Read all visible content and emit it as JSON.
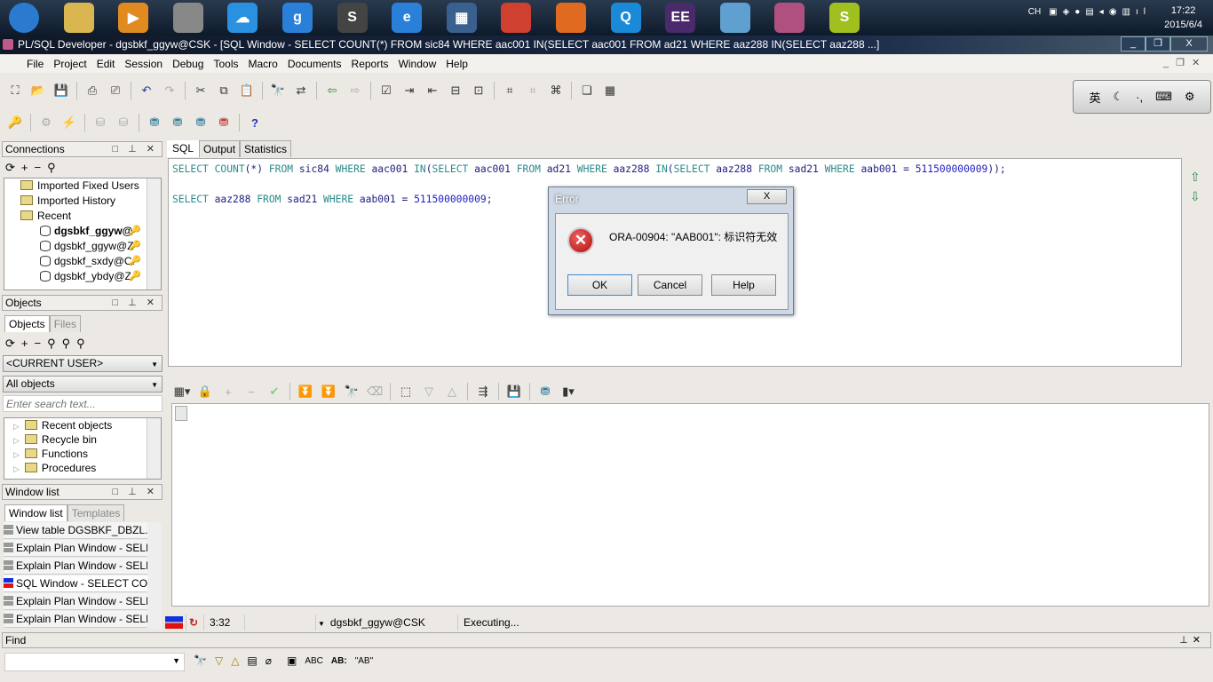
{
  "taskbar": {
    "apps": [
      {
        "name": "start-button",
        "label": "",
        "color": "#2a7ad0"
      },
      {
        "name": "file-explorer",
        "label": "",
        "color": "#d9b650"
      },
      {
        "name": "media-player",
        "label": "▶",
        "color": "#e08a20"
      },
      {
        "name": "speaker-app",
        "label": "",
        "color": "#888"
      },
      {
        "name": "baidu-cloud",
        "label": "☁",
        "color": "#2a90e0"
      },
      {
        "name": "app-blue",
        "label": "g",
        "color": "#2a80d8"
      },
      {
        "name": "sublime-text",
        "label": "S",
        "color": "#444"
      },
      {
        "name": "internet-explorer",
        "label": "e",
        "color": "#2a80d8"
      },
      {
        "name": "video-app",
        "label": "▦",
        "color": "#3a6090"
      },
      {
        "name": "chrome",
        "label": "",
        "color": "#d04030"
      },
      {
        "name": "firefox",
        "label": "",
        "color": "#e06a20"
      },
      {
        "name": "app-q",
        "label": "Q",
        "color": "#1a8ad8"
      },
      {
        "name": "java-ee-ide",
        "label": "EE",
        "color": "#4a2a6a"
      },
      {
        "name": "paint-app",
        "label": "",
        "color": "#60a0d0"
      },
      {
        "name": "plsql-developer",
        "label": "",
        "color": "#b05080"
      },
      {
        "name": "app-green",
        "label": "S",
        "color": "#a0c020"
      }
    ],
    "tray": {
      "lang": "CH",
      "time": "17:22",
      "date": "2015/6/4"
    }
  },
  "window": {
    "title": "PL/SQL Developer - dgsbkf_ggyw@CSK - [SQL Window - SELECT COUNT(*) FROM sic84 WHERE aac001 IN(SELECT aac001 FROM ad21 WHERE aaz288 IN(SELECT aaz288 ...]"
  },
  "menu": [
    "File",
    "Project",
    "Edit",
    "Session",
    "Debug",
    "Tools",
    "Macro",
    "Documents",
    "Reports",
    "Window",
    "Help"
  ],
  "ime": {
    "items": [
      "英",
      "☾",
      "·,",
      "⌨",
      "⚙"
    ]
  },
  "connections": {
    "title": "Connections",
    "items": [
      {
        "label": "Imported Fixed Users",
        "type": "folder"
      },
      {
        "label": "Imported History",
        "type": "folder"
      },
      {
        "label": "Recent",
        "type": "folder"
      },
      {
        "label": "dgsbkf_ggyw@",
        "type": "db",
        "bold": true
      },
      {
        "label": "dgsbkf_ggyw@Z",
        "type": "db"
      },
      {
        "label": "dgsbkf_sxdy@C:",
        "type": "db"
      },
      {
        "label": "dgsbkf_ybdy@Z",
        "type": "db"
      }
    ]
  },
  "objects": {
    "title": "Objects",
    "tabs": [
      "Objects",
      "Files"
    ],
    "user_select": "<CURRENT USER>",
    "filter_select": "All objects",
    "search_placeholder": "Enter search text...",
    "items": [
      "Recent objects",
      "Recycle bin",
      "Functions",
      "Procedures"
    ]
  },
  "window_list": {
    "title": "Window list",
    "tabs": [
      "Window list",
      "Templates"
    ],
    "items": [
      {
        "label": "View table DGSBKF_DBZL.SIC",
        "sql": false
      },
      {
        "label": "Explain Plan Window - SELECT",
        "sql": false
      },
      {
        "label": "Explain Plan Window - SELECT",
        "sql": false
      },
      {
        "label": "SQL Window - SELECT COUN",
        "sql": true
      },
      {
        "label": "Explain Plan Window - SELECT",
        "sql": false
      },
      {
        "label": "Explain Plan Window - SELECT",
        "sql": false
      }
    ]
  },
  "editor": {
    "tabs": [
      "SQL",
      "Output",
      "Statistics"
    ],
    "lines": [
      [
        [
          "kw",
          "SELECT "
        ],
        [
          "kw",
          "COUNT"
        ],
        [
          "id",
          "(*) "
        ],
        [
          "kw",
          "FROM "
        ],
        [
          "id",
          "sic84 "
        ],
        [
          "kw",
          "WHERE "
        ],
        [
          "id",
          "aac001 "
        ],
        [
          "kw",
          "IN"
        ],
        [
          "id",
          "("
        ],
        [
          "kw",
          "SELECT "
        ],
        [
          "id",
          "aac001 "
        ],
        [
          "kw",
          "FROM "
        ],
        [
          "id",
          "ad21 "
        ],
        [
          "kw",
          "WHERE "
        ],
        [
          "id",
          "aaz288 "
        ],
        [
          "kw",
          "IN"
        ],
        [
          "id",
          "("
        ],
        [
          "kw",
          "SELECT "
        ],
        [
          "id",
          "aaz288 "
        ],
        [
          "kw",
          "FROM "
        ],
        [
          "id",
          "sad21 "
        ],
        [
          "kw",
          "WHERE "
        ],
        [
          "id",
          "aab001 = "
        ],
        [
          "num",
          "511500000009"
        ],
        [
          "id",
          "));"
        ]
      ],
      [],
      [
        [
          "kw",
          "SELECT "
        ],
        [
          "id",
          "aaz288 "
        ],
        [
          "kw",
          "FROM "
        ],
        [
          "id",
          "sad21 "
        ],
        [
          "kw",
          "WHERE "
        ],
        [
          "id",
          "aab001 = "
        ],
        [
          "num",
          "511500000009"
        ],
        [
          "id",
          ";"
        ]
      ]
    ]
  },
  "status": {
    "time": "3:32",
    "connection": "dgsbkf_ggyw@CSK",
    "message": "Executing..."
  },
  "find": {
    "title": "Find",
    "buttons": [
      "ABC",
      "AB:",
      "\"AB\""
    ]
  },
  "dialog": {
    "title": "Error",
    "message": "ORA-00904: \"AAB001\": 标识符无效",
    "ok": "OK",
    "cancel": "Cancel",
    "help": "Help",
    "close": "X"
  }
}
